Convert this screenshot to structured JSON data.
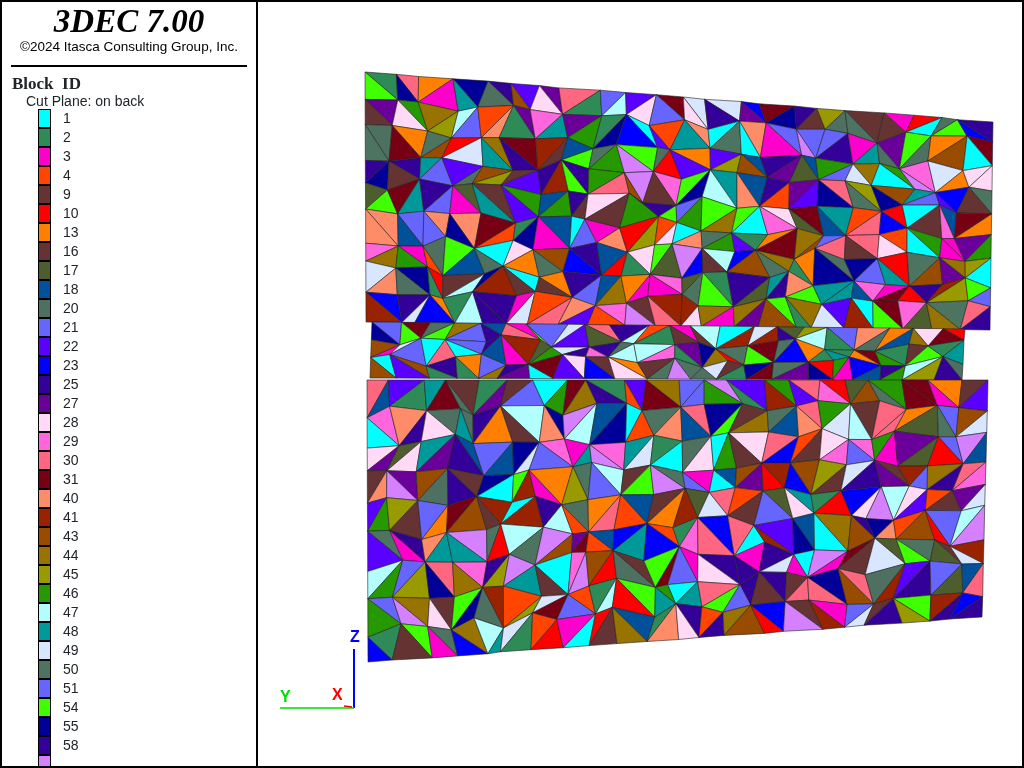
{
  "header": {
    "title": "3DEC 7.00",
    "copyright": "©2024 Itasca Consulting Group, Inc."
  },
  "legend": {
    "title": "Block  ID",
    "subtitle": "Cut Plane: on back",
    "items": [
      {
        "label": "1",
        "color": "#00ffff"
      },
      {
        "label": "2",
        "color": "#2e8b57"
      },
      {
        "label": "3",
        "color": "#ff00cc"
      },
      {
        "label": "4",
        "color": "#ff4500"
      },
      {
        "label": "9",
        "color": "#663333"
      },
      {
        "label": "10",
        "color": "#ff0000"
      },
      {
        "label": "13",
        "color": "#ff8000"
      },
      {
        "label": "16",
        "color": "#663334"
      },
      {
        "label": "17",
        "color": "#4d5d2d"
      },
      {
        "label": "18",
        "color": "#00509a"
      },
      {
        "label": "20",
        "color": "#4e7060"
      },
      {
        "label": "21",
        "color": "#6666ff"
      },
      {
        "label": "22",
        "color": "#5a00ff"
      },
      {
        "label": "23",
        "color": "#0000ff"
      },
      {
        "label": "25",
        "color": "#330099"
      },
      {
        "label": "27",
        "color": "#6a0099"
      },
      {
        "label": "28",
        "color": "#ffd9f5"
      },
      {
        "label": "29",
        "color": "#ff66dd"
      },
      {
        "label": "30",
        "color": "#ff6680"
      },
      {
        "label": "31",
        "color": "#770015"
      },
      {
        "label": "40",
        "color": "#ff8c69"
      },
      {
        "label": "41",
        "color": "#992200"
      },
      {
        "label": "43",
        "color": "#994c00"
      },
      {
        "label": "44",
        "color": "#997300"
      },
      {
        "label": "45",
        "color": "#999900"
      },
      {
        "label": "46",
        "color": "#269900"
      },
      {
        "label": "47",
        "color": "#b3ffff"
      },
      {
        "label": "48",
        "color": "#009999"
      },
      {
        "label": "49",
        "color": "#d9e6ff"
      },
      {
        "label": "50",
        "color": "#4d7361"
      },
      {
        "label": "51",
        "color": "#6666fe"
      },
      {
        "label": "54",
        "color": "#40ff00"
      },
      {
        "label": "55",
        "color": "#000099"
      },
      {
        "label": "58",
        "color": "#330098"
      },
      {
        "color": "#d580ff"
      }
    ]
  },
  "axes": {
    "z": "Z",
    "y": "Y",
    "x": "X"
  }
}
